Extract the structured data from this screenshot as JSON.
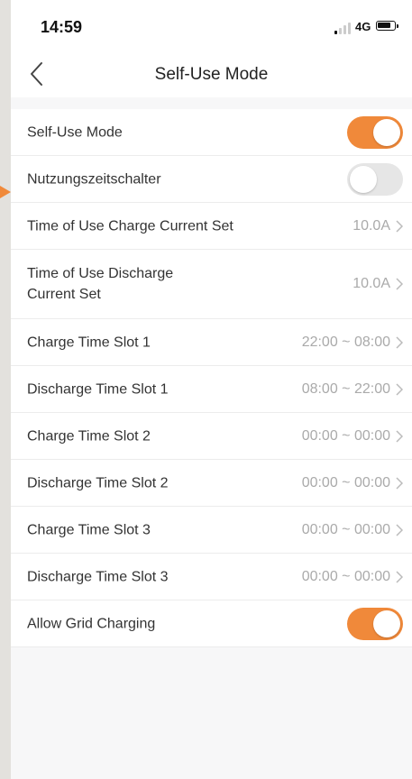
{
  "status_bar": {
    "time": "14:59",
    "network": "4G"
  },
  "nav": {
    "title": "Self-Use Mode"
  },
  "colors": {
    "accent": "#f0893a",
    "toggle_off": "#e6e6e6"
  },
  "rows": [
    {
      "label": "Self-Use Mode",
      "type": "toggle",
      "on": true
    },
    {
      "label": "Nutzungszeitschalter",
      "type": "toggle",
      "on": false
    },
    {
      "label": "Time of Use Charge Current Set",
      "type": "value",
      "value": "10.0A"
    },
    {
      "label": "Time of Use Discharge Current Set",
      "type": "value",
      "value": "10.0A"
    },
    {
      "label": "Charge Time Slot 1",
      "type": "value",
      "value": "22:00 ~ 08:00"
    },
    {
      "label": "Discharge Time Slot 1",
      "type": "value",
      "value": "08:00 ~ 22:00"
    },
    {
      "label": "Charge Time Slot 2",
      "type": "value",
      "value": "00:00 ~ 00:00"
    },
    {
      "label": "Discharge Time Slot 2",
      "type": "value",
      "value": "00:00 ~ 00:00"
    },
    {
      "label": "Charge Time Slot 3",
      "type": "value",
      "value": "00:00 ~ 00:00"
    },
    {
      "label": "Discharge Time Slot 3",
      "type": "value",
      "value": "00:00 ~ 00:00"
    },
    {
      "label": "Allow Grid Charging",
      "type": "toggle",
      "on": true
    }
  ]
}
